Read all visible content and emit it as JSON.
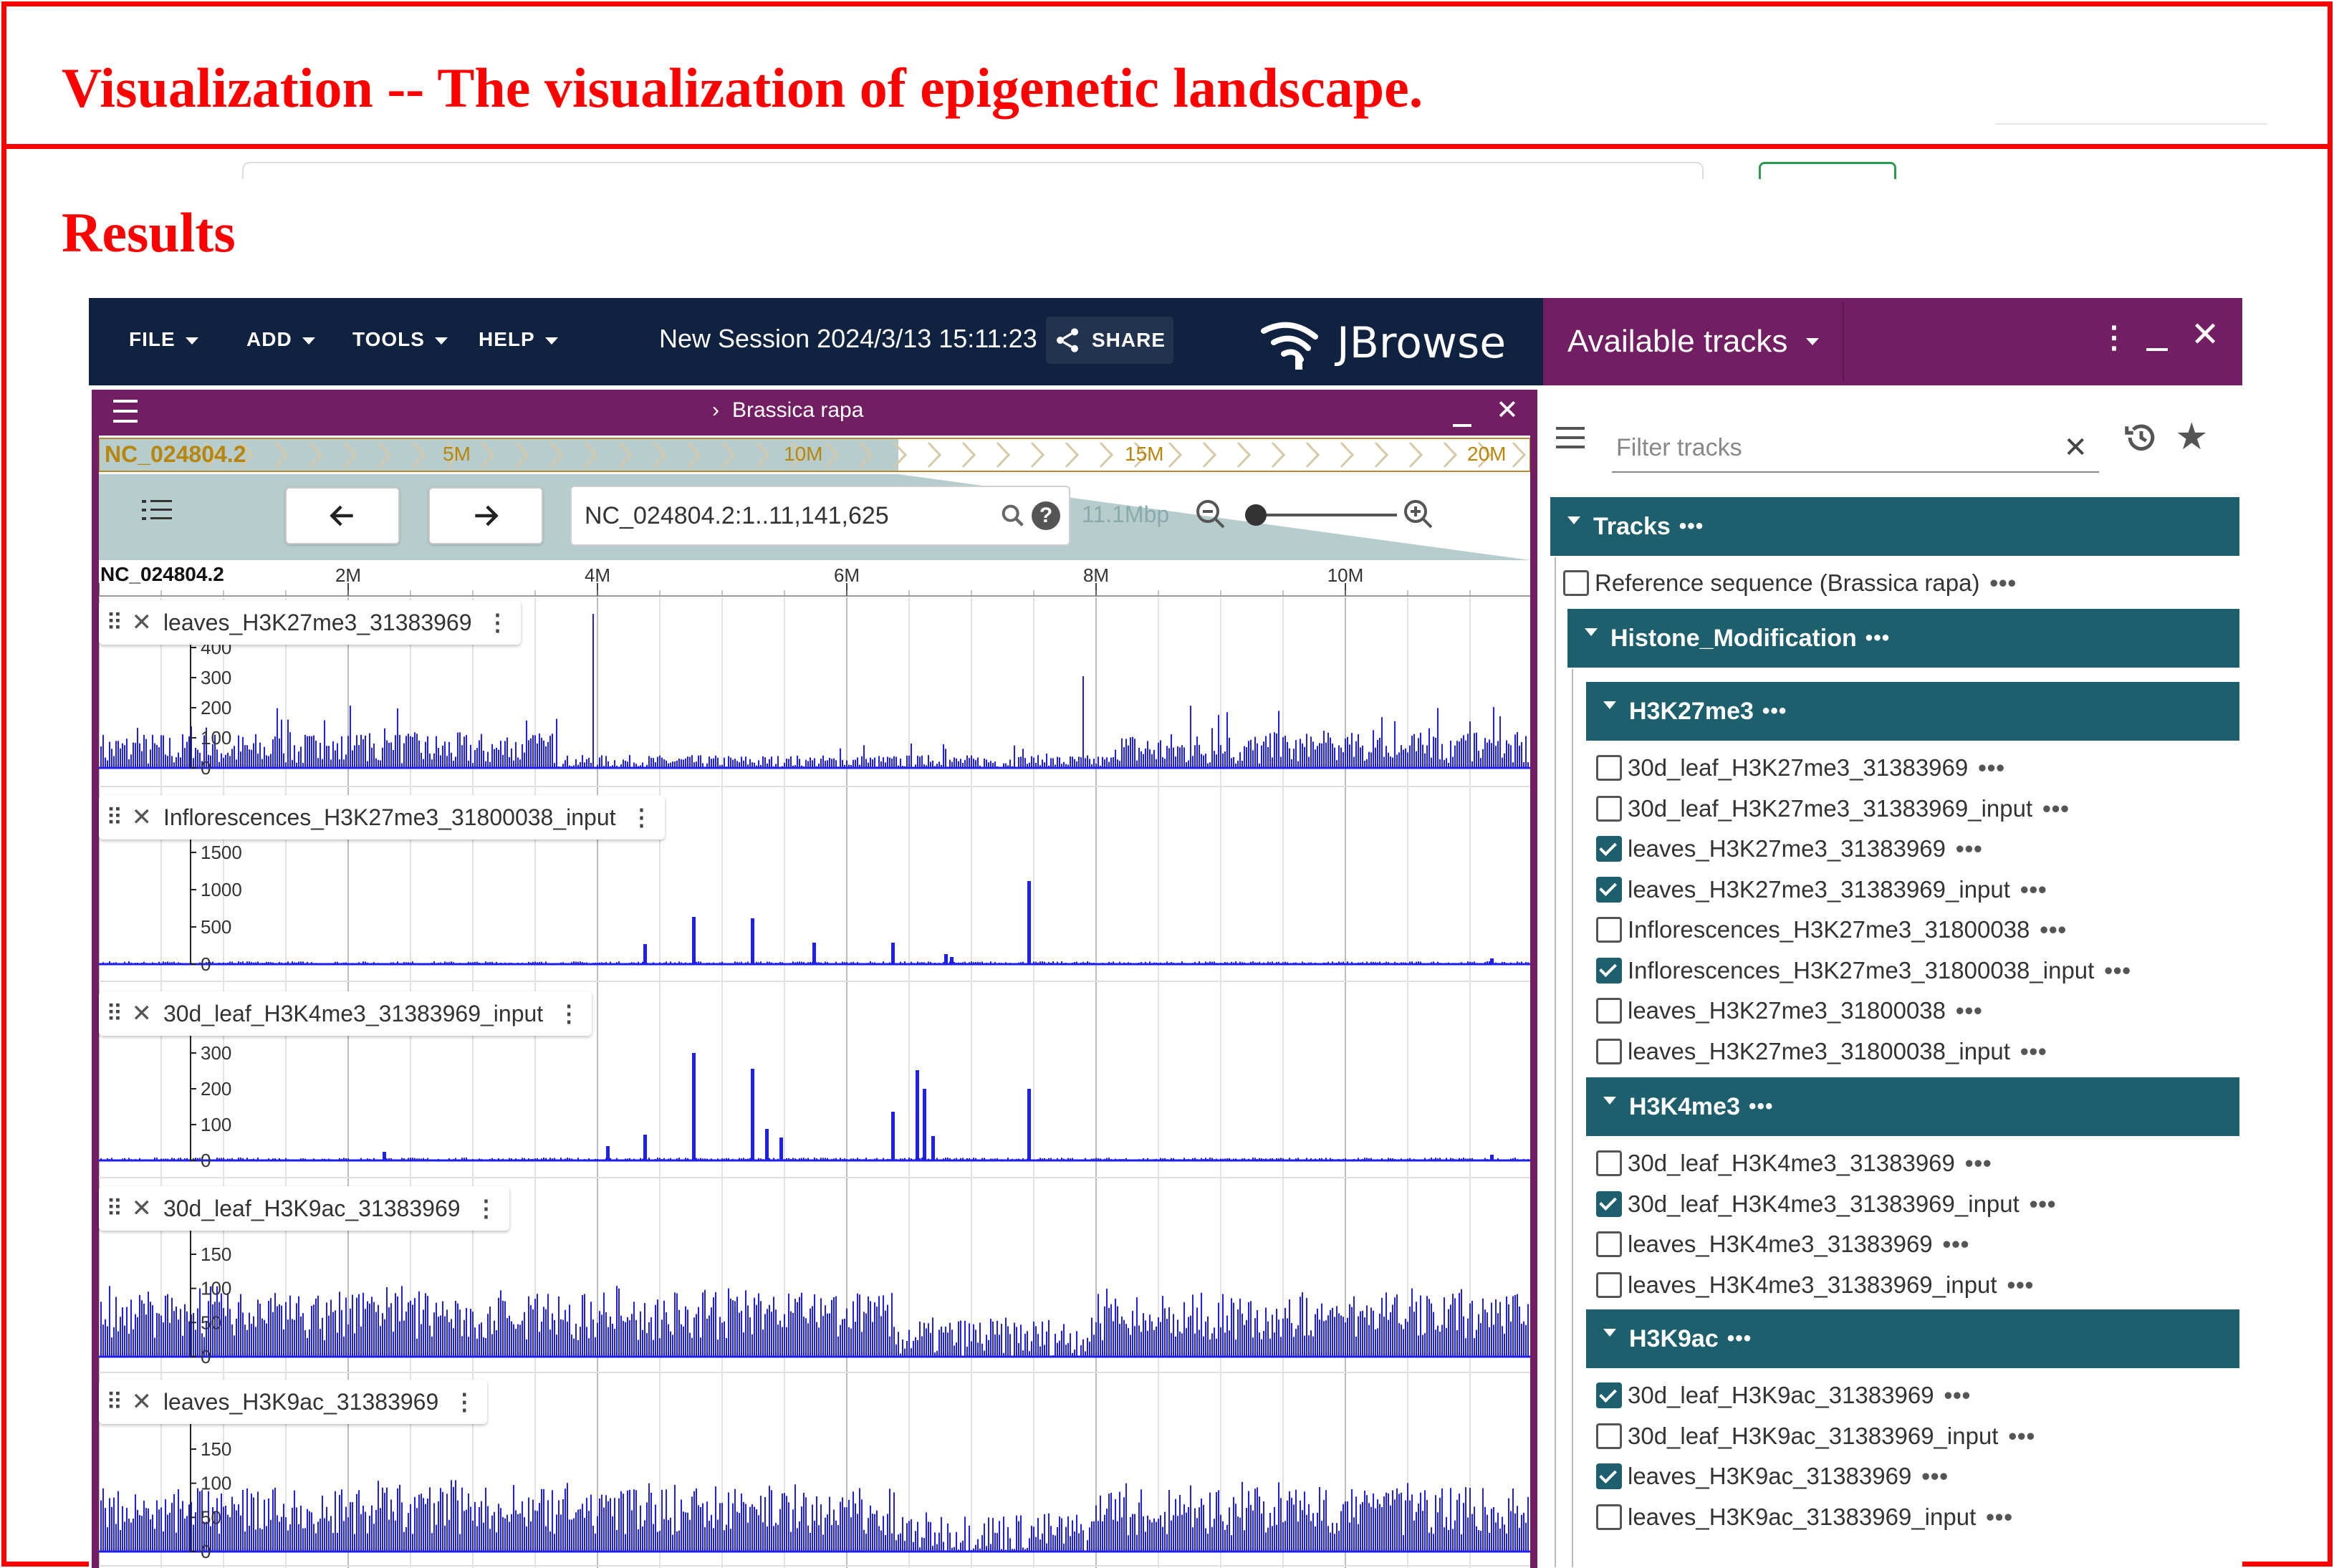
{
  "page": {
    "heading": "Visualization -- The visualization of epigenetic landscape.",
    "subheading": "Results",
    "accent_color": "#ff0000"
  },
  "jbrowse": {
    "menu": {
      "file": "FILE",
      "add": "ADD",
      "tools": "TOOLS",
      "help": "HELP"
    },
    "session_title": "New Session 2024/3/13 15:11:23",
    "share_label": "SHARE",
    "brand": "JBrowse",
    "colors": {
      "navy": "#0f2240",
      "purple": "#721e63",
      "teal": "#1d5f6c",
      "signal": "#1e1ef0"
    }
  },
  "view": {
    "assembly": "Brassica rapa",
    "chrom": "NC_024804.2",
    "overview_ticks": [
      "5M",
      "10M",
      "15M",
      "20M"
    ],
    "location": "NC_024804.2:1..11,141,625",
    "span": "11.1Mbp",
    "ruler_chrom": "NC_024804.2",
    "ruler_ticks": [
      "2M",
      "4M",
      "6M",
      "8M",
      "10M"
    ]
  },
  "tracks": [
    {
      "label": "leaves_H3K27me3_31383969",
      "ticks": [
        "400",
        "300",
        "200",
        "100",
        "0"
      ],
      "max": 400
    },
    {
      "label": "Inflorescences_H3K27me3_31800038_input",
      "ticks": [
        "1500",
        "1000",
        "500",
        "0"
      ],
      "max": 1800
    },
    {
      "label": "30d_leaf_H3K4me3_31383969_input",
      "ticks": [
        "300",
        "200",
        "100",
        "0"
      ],
      "max": 380
    },
    {
      "label": "30d_leaf_H3K9ac_31383969",
      "ticks": [
        "150",
        "100",
        "50",
        "0"
      ],
      "max": 200
    },
    {
      "label": "leaves_H3K9ac_31383969",
      "ticks": [
        "150",
        "100",
        "50",
        "0"
      ],
      "max": 200
    }
  ],
  "selector": {
    "title": "Available tracks",
    "filter_placeholder": "Filter tracks",
    "tracks_header": "Tracks",
    "reference": "Reference sequence (Brassica rapa)",
    "category": "Histone_Modification",
    "groups": [
      {
        "name": "H3K27me3",
        "items": [
          {
            "label": "30d_leaf_H3K27me3_31383969",
            "checked": false
          },
          {
            "label": "30d_leaf_H3K27me3_31383969_input",
            "checked": false
          },
          {
            "label": "leaves_H3K27me3_31383969",
            "checked": true
          },
          {
            "label": "leaves_H3K27me3_31383969_input",
            "checked": true
          },
          {
            "label": "Inflorescences_H3K27me3_31800038",
            "checked": false
          },
          {
            "label": "Inflorescences_H3K27me3_31800038_input",
            "checked": true
          },
          {
            "label": "leaves_H3K27me3_31800038",
            "checked": false
          },
          {
            "label": "leaves_H3K27me3_31800038_input",
            "checked": false
          }
        ]
      },
      {
        "name": "H3K4me3",
        "items": [
          {
            "label": "30d_leaf_H3K4me3_31383969",
            "checked": false
          },
          {
            "label": "30d_leaf_H3K4me3_31383969_input",
            "checked": true
          },
          {
            "label": "leaves_H3K4me3_31383969",
            "checked": false
          },
          {
            "label": "leaves_H3K4me3_31383969_input",
            "checked": false
          }
        ]
      },
      {
        "name": "H3K9ac",
        "items": [
          {
            "label": "30d_leaf_H3K9ac_31383969",
            "checked": true
          },
          {
            "label": "30d_leaf_H3K9ac_31383969_input",
            "checked": false
          },
          {
            "label": "leaves_H3K9ac_31383969",
            "checked": true
          },
          {
            "label": "leaves_H3K9ac_31383969_input",
            "checked": false
          }
        ]
      }
    ]
  }
}
